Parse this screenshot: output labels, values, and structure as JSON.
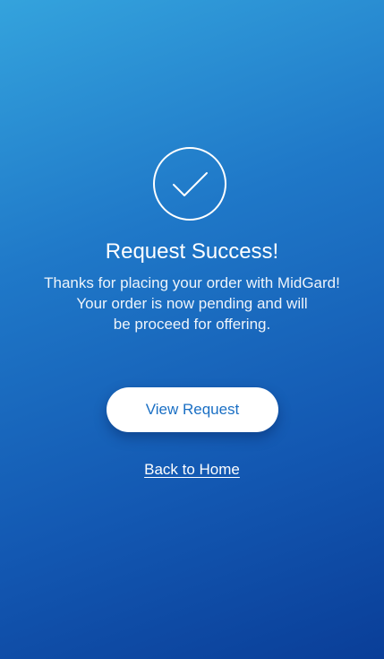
{
  "success": {
    "icon": "checkmark-circle-icon",
    "title": "Request Success!",
    "message_lines": [
      "Thanks for placing your order with MidGard!",
      "Your order is now pending and will",
      "be proceed for offering."
    ]
  },
  "actions": {
    "view_request_label": "View Request",
    "back_home_label": "Back to Home"
  },
  "colors": {
    "gradient_top": "#34a3dd",
    "gradient_bottom": "#0a3e98",
    "button_text": "#1a6fc4",
    "button_bg": "#ffffff"
  }
}
